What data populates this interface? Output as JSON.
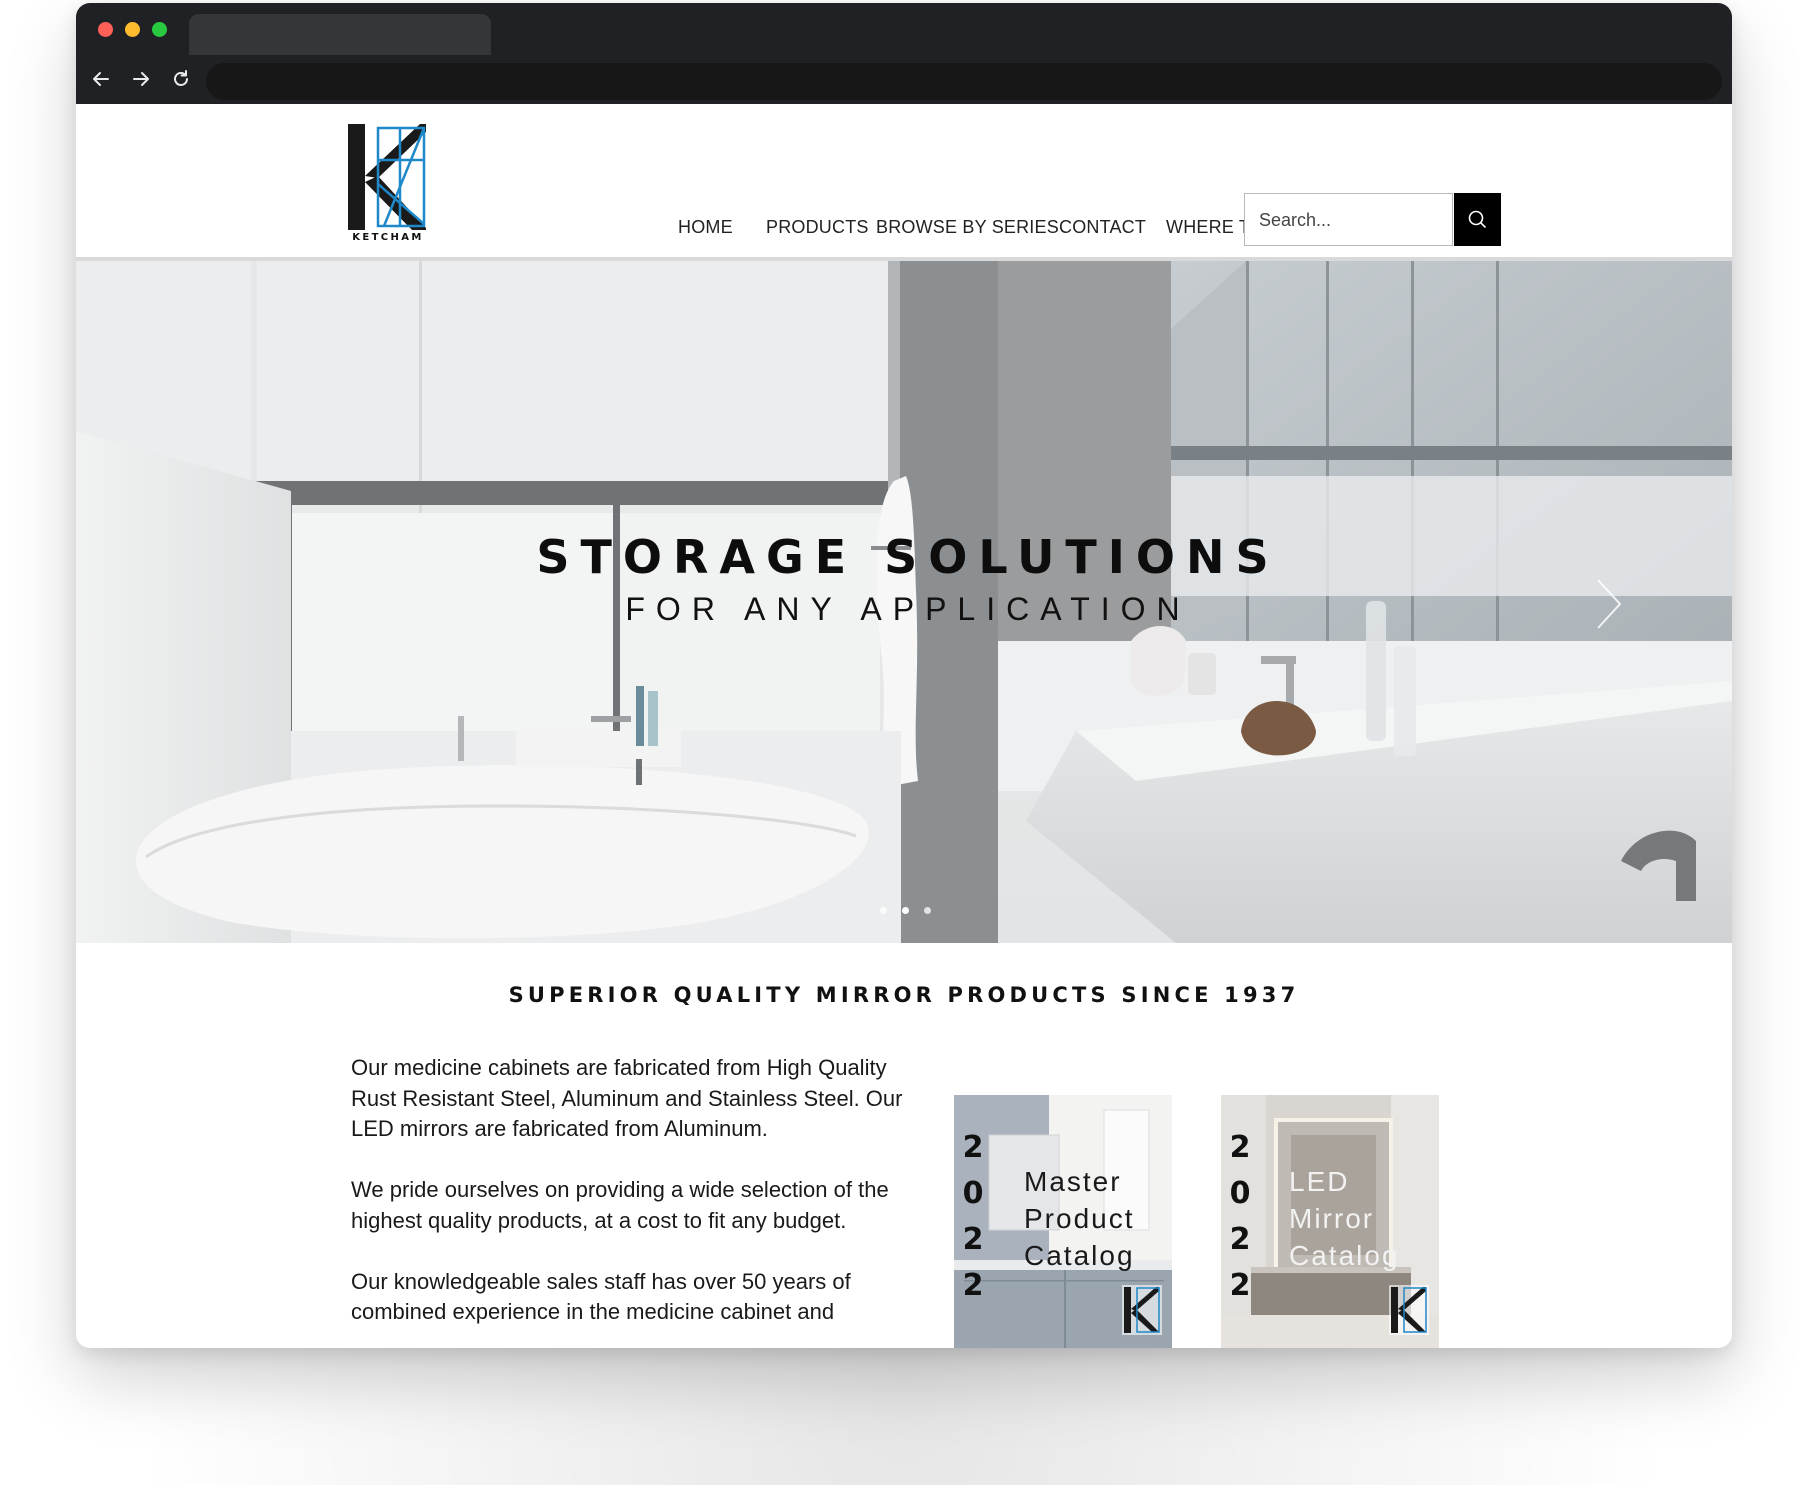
{
  "header": {
    "brand": "KETCHAM",
    "nav": [
      {
        "label": "HOME"
      },
      {
        "label": "PRODUCTS"
      },
      {
        "label": "BROWSE BY SERIES"
      },
      {
        "label": "CONTACT"
      },
      {
        "label": "WHERE TO BUY"
      }
    ],
    "search": {
      "placeholder": "Search..."
    }
  },
  "hero": {
    "title": "STORAGE SOLUTIONS",
    "subtitle": "FOR ANY APPLICATION",
    "slide_count": 3,
    "active_slide": 2
  },
  "main": {
    "tagline": "SUPERIOR QUALITY MIRROR PRODUCTS SINCE 1937",
    "paragraphs": [
      "Our medicine cabinets are fabricated from High Quality Rust Resistant Steel, Aluminum and Stainless Steel. Our LED mirrors are fabricated from Aluminum.",
      "We pride ourselves on providing a wide selection of the highest quality products, at a cost to fit any budget.",
      "Our knowledgeable sales staff has over 50 years of combined experience in the medicine cabinet and"
    ],
    "catalogs": [
      {
        "year_digits": [
          "2",
          "0",
          "2",
          "2"
        ],
        "title_lines": [
          "Master",
          "Product",
          "Catalog"
        ]
      },
      {
        "year_digits": [
          "2",
          "0",
          "2",
          "2"
        ],
        "title_lines": [
          "LED",
          "Mirror",
          "Catalog"
        ]
      }
    ]
  },
  "colors": {
    "brand_blue": "#1e88c8",
    "chrome_dark": "#202124",
    "search_button": "#000000"
  },
  "icons": [
    "arrow-left-icon",
    "arrow-right-icon",
    "reload-icon",
    "search-icon",
    "chevron-right-icon"
  ]
}
